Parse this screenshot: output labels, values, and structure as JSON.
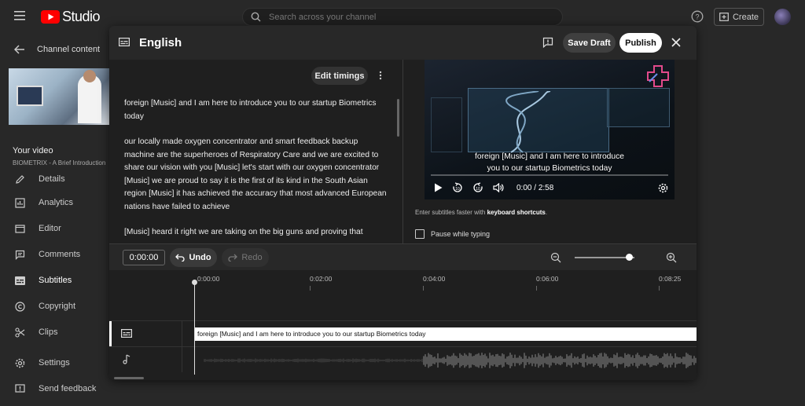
{
  "app": {
    "logo_text": "Studio",
    "search_placeholder": "Search across your channel",
    "create_label": "Create"
  },
  "sidebar": {
    "back_label": "Channel content",
    "your_video_label": "Your video",
    "video_title": "BIOMETRIX - A Brief Introduction",
    "items": [
      {
        "label": "Details",
        "icon": "pencil-icon"
      },
      {
        "label": "Analytics",
        "icon": "bar-chart-icon"
      },
      {
        "label": "Editor",
        "icon": "film-icon"
      },
      {
        "label": "Comments",
        "icon": "comment-icon"
      },
      {
        "label": "Subtitles",
        "icon": "subtitles-icon"
      },
      {
        "label": "Copyright",
        "icon": "copyright-icon"
      },
      {
        "label": "Clips",
        "icon": "scissors-icon"
      }
    ],
    "bottom_items": [
      {
        "label": "Settings",
        "icon": "gear-icon"
      },
      {
        "label": "Send feedback",
        "icon": "feedback-icon"
      }
    ]
  },
  "modal": {
    "title": "English",
    "save_draft_label": "Save Draft",
    "publish_label": "Publish",
    "edit_timings_label": "Edit timings",
    "transcript": [
      "foreign [Music] and I am here to introduce you to our startup Biometrics today",
      "our locally made oxygen concentrator and smart feedback backup machine are the superheroes of Respiratory Care and we are excited to share our vision with you [Music] let's start with our oxygen concentrator [Music] we are proud to say it is the first of its kind in the South Asian region [Music] it has achieved the accuracy that most advanced European nations have failed to achieve",
      "[Music] heard it right we are taking on the big guns and proving that"
    ],
    "video": {
      "caption_line1": "foreign [Music] and I am here to introduce",
      "caption_line2": "you to our startup Biometrics today",
      "current_time": "0:00",
      "duration": "2:58",
      "progress": 0.0
    },
    "shortcuts_hint_prefix": "Enter subtitles faster with ",
    "shortcuts_hint_link": "keyboard shortcuts",
    "shortcuts_hint_suffix": ".",
    "pause_while_typing_label": "Pause while typing",
    "pause_while_typing_checked": false,
    "toolbar": {
      "time_value": "0:00:00",
      "undo_label": "Undo",
      "redo_label": "Redo",
      "zoom_level": 0.92
    },
    "timeline": {
      "ruler_labels": [
        "0:00:00",
        "0:02:00",
        "0:04:00",
        "0:06:00",
        "0:08:25"
      ],
      "caption_block_text": "foreign [Music] and I am here to introduce  you to our startup Biometrics today"
    }
  }
}
